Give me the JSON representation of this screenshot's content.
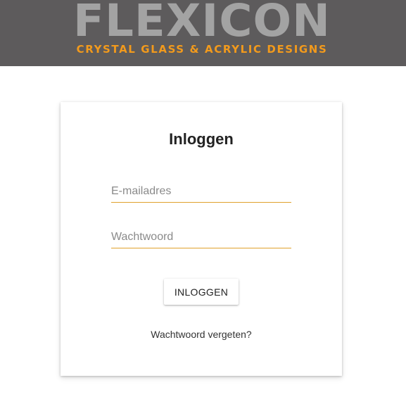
{
  "header": {
    "brand_name": "FLEXICON",
    "brand_tagline": "CRYSTAL GLASS & ACRYLIC DESIGNS",
    "background_color": "#5d5b5c",
    "brand_color": "#a3a3a3",
    "tagline_color": "#f29a1c"
  },
  "login": {
    "title": "Inloggen",
    "email_placeholder": "E-mailadres",
    "password_placeholder": "Wachtwoord",
    "submit_label": "INLOGGEN",
    "forgot_password_label": "Wachtwoord vergeten?",
    "accent_color": "#e0a12c"
  }
}
